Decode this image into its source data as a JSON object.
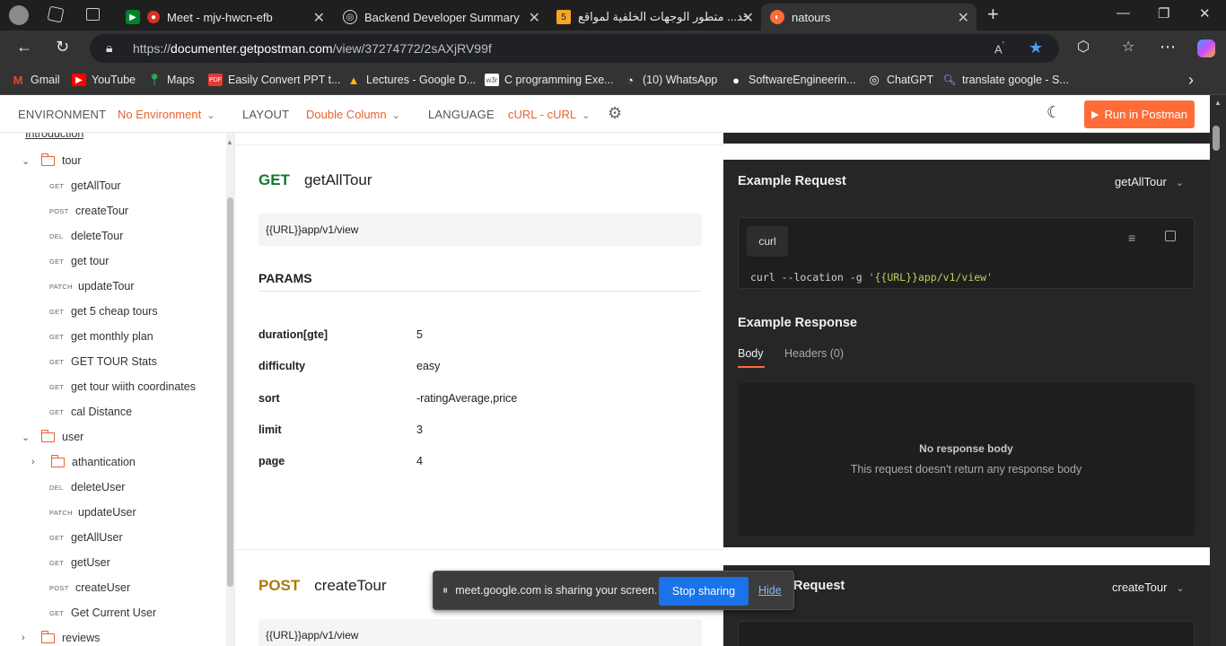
{
  "browser": {
    "tabs": [
      {
        "title": "Meet - mjv-hwcn-efb"
      },
      {
        "title": "Backend Developer Summary"
      },
      {
        "title": "خد... متطور الوجهات الخلفية لمواقع"
      },
      {
        "title": "natours"
      }
    ],
    "url_prefix": "https://",
    "url_host": "documenter.getpostman.com",
    "url_path": "/view/37274772/2sAXjRV99f",
    "bookmarks": [
      {
        "label": "Gmail",
        "icon": "gmail-icon"
      },
      {
        "label": "YouTube",
        "icon": "youtube-icon"
      },
      {
        "label": "Maps",
        "icon": "maps-icon"
      },
      {
        "label": "Easily Convert PPT t...",
        "icon": "pdf-icon"
      },
      {
        "label": "Lectures - Google D...",
        "icon": "drive-icon"
      },
      {
        "label": "C programming Exe...",
        "icon": "w3r-icon"
      },
      {
        "label": "(10) WhatsApp",
        "icon": "whatsapp-icon"
      },
      {
        "label": "SoftwareEngineerin...",
        "icon": "github-icon"
      },
      {
        "label": "ChatGPT",
        "icon": "chatgpt-icon"
      },
      {
        "label": "translate google - S...",
        "icon": "search-icon"
      }
    ]
  },
  "header": {
    "env_label": "ENVIRONMENT",
    "env_value": "No Environment",
    "layout_label": "LAYOUT",
    "layout_value": "Double Column",
    "language_label": "LANGUAGE",
    "language_value": "cURL - cURL",
    "run_label": "Run in Postman"
  },
  "sidebar": {
    "intro": "Introduction",
    "tour_folder": "tour",
    "tour_items": [
      {
        "method": "GET",
        "name": "getAllTour"
      },
      {
        "method": "POST",
        "name": "createTour"
      },
      {
        "method": "DEL",
        "name": "deleteTour"
      },
      {
        "method": "GET",
        "name": "get tour"
      },
      {
        "method": "PATCH",
        "name": "updateTour"
      },
      {
        "method": "GET",
        "name": "get 5 cheap tours"
      },
      {
        "method": "GET",
        "name": "get monthly plan"
      },
      {
        "method": "GET",
        "name": "GET TOUR Stats"
      },
      {
        "method": "GET",
        "name": "get tour wiith coordinates"
      },
      {
        "method": "GET",
        "name": "cal Distance"
      }
    ],
    "user_folder": "user",
    "user_subfolder": "athantication",
    "user_items": [
      {
        "method": "DEL",
        "name": "deleteUser"
      },
      {
        "method": "PATCH",
        "name": "updateUser"
      },
      {
        "method": "GET",
        "name": "getAllUser"
      },
      {
        "method": "GET",
        "name": "getUser"
      },
      {
        "method": "POST",
        "name": "createUser"
      },
      {
        "method": "GET",
        "name": "Get Current User"
      }
    ],
    "reviews_folder": "reviews"
  },
  "main": {
    "req1": {
      "method": "GET",
      "name": "getAllTour",
      "url": "{{URL}}app/v1/view",
      "params_title": "PARAMS",
      "params": [
        {
          "key": "duration[gte]",
          "value": "5"
        },
        {
          "key": "difficulty",
          "value": "easy"
        },
        {
          "key": "sort",
          "value": "-ratingAverage,price"
        },
        {
          "key": "limit",
          "value": "3"
        },
        {
          "key": "page",
          "value": "4"
        }
      ]
    },
    "req2": {
      "method": "POST",
      "name": "createTour",
      "url": "{{URL}}app/v1/view"
    }
  },
  "right": {
    "example_request": "Example Request",
    "selected1": "getAllTour",
    "curl_tag": "curl",
    "code_prefix": "curl --location -g ",
    "code_str": "'{{URL}}app/v1/view'",
    "example_response": "Example Response",
    "tab_body": "Body",
    "tab_headers": "Headers (0)",
    "no_body": "No response body",
    "no_body_desc": "This request doesn't return any response body",
    "example_request2": "Request",
    "selected2": "createTour"
  },
  "share": {
    "text": "meet.google.com is sharing your screen.",
    "stop": "Stop sharing",
    "hide": "Hide"
  },
  "colors": {
    "accent": "#ff6c37",
    "get": "#0f7b2e",
    "post": "#ad7a03"
  }
}
